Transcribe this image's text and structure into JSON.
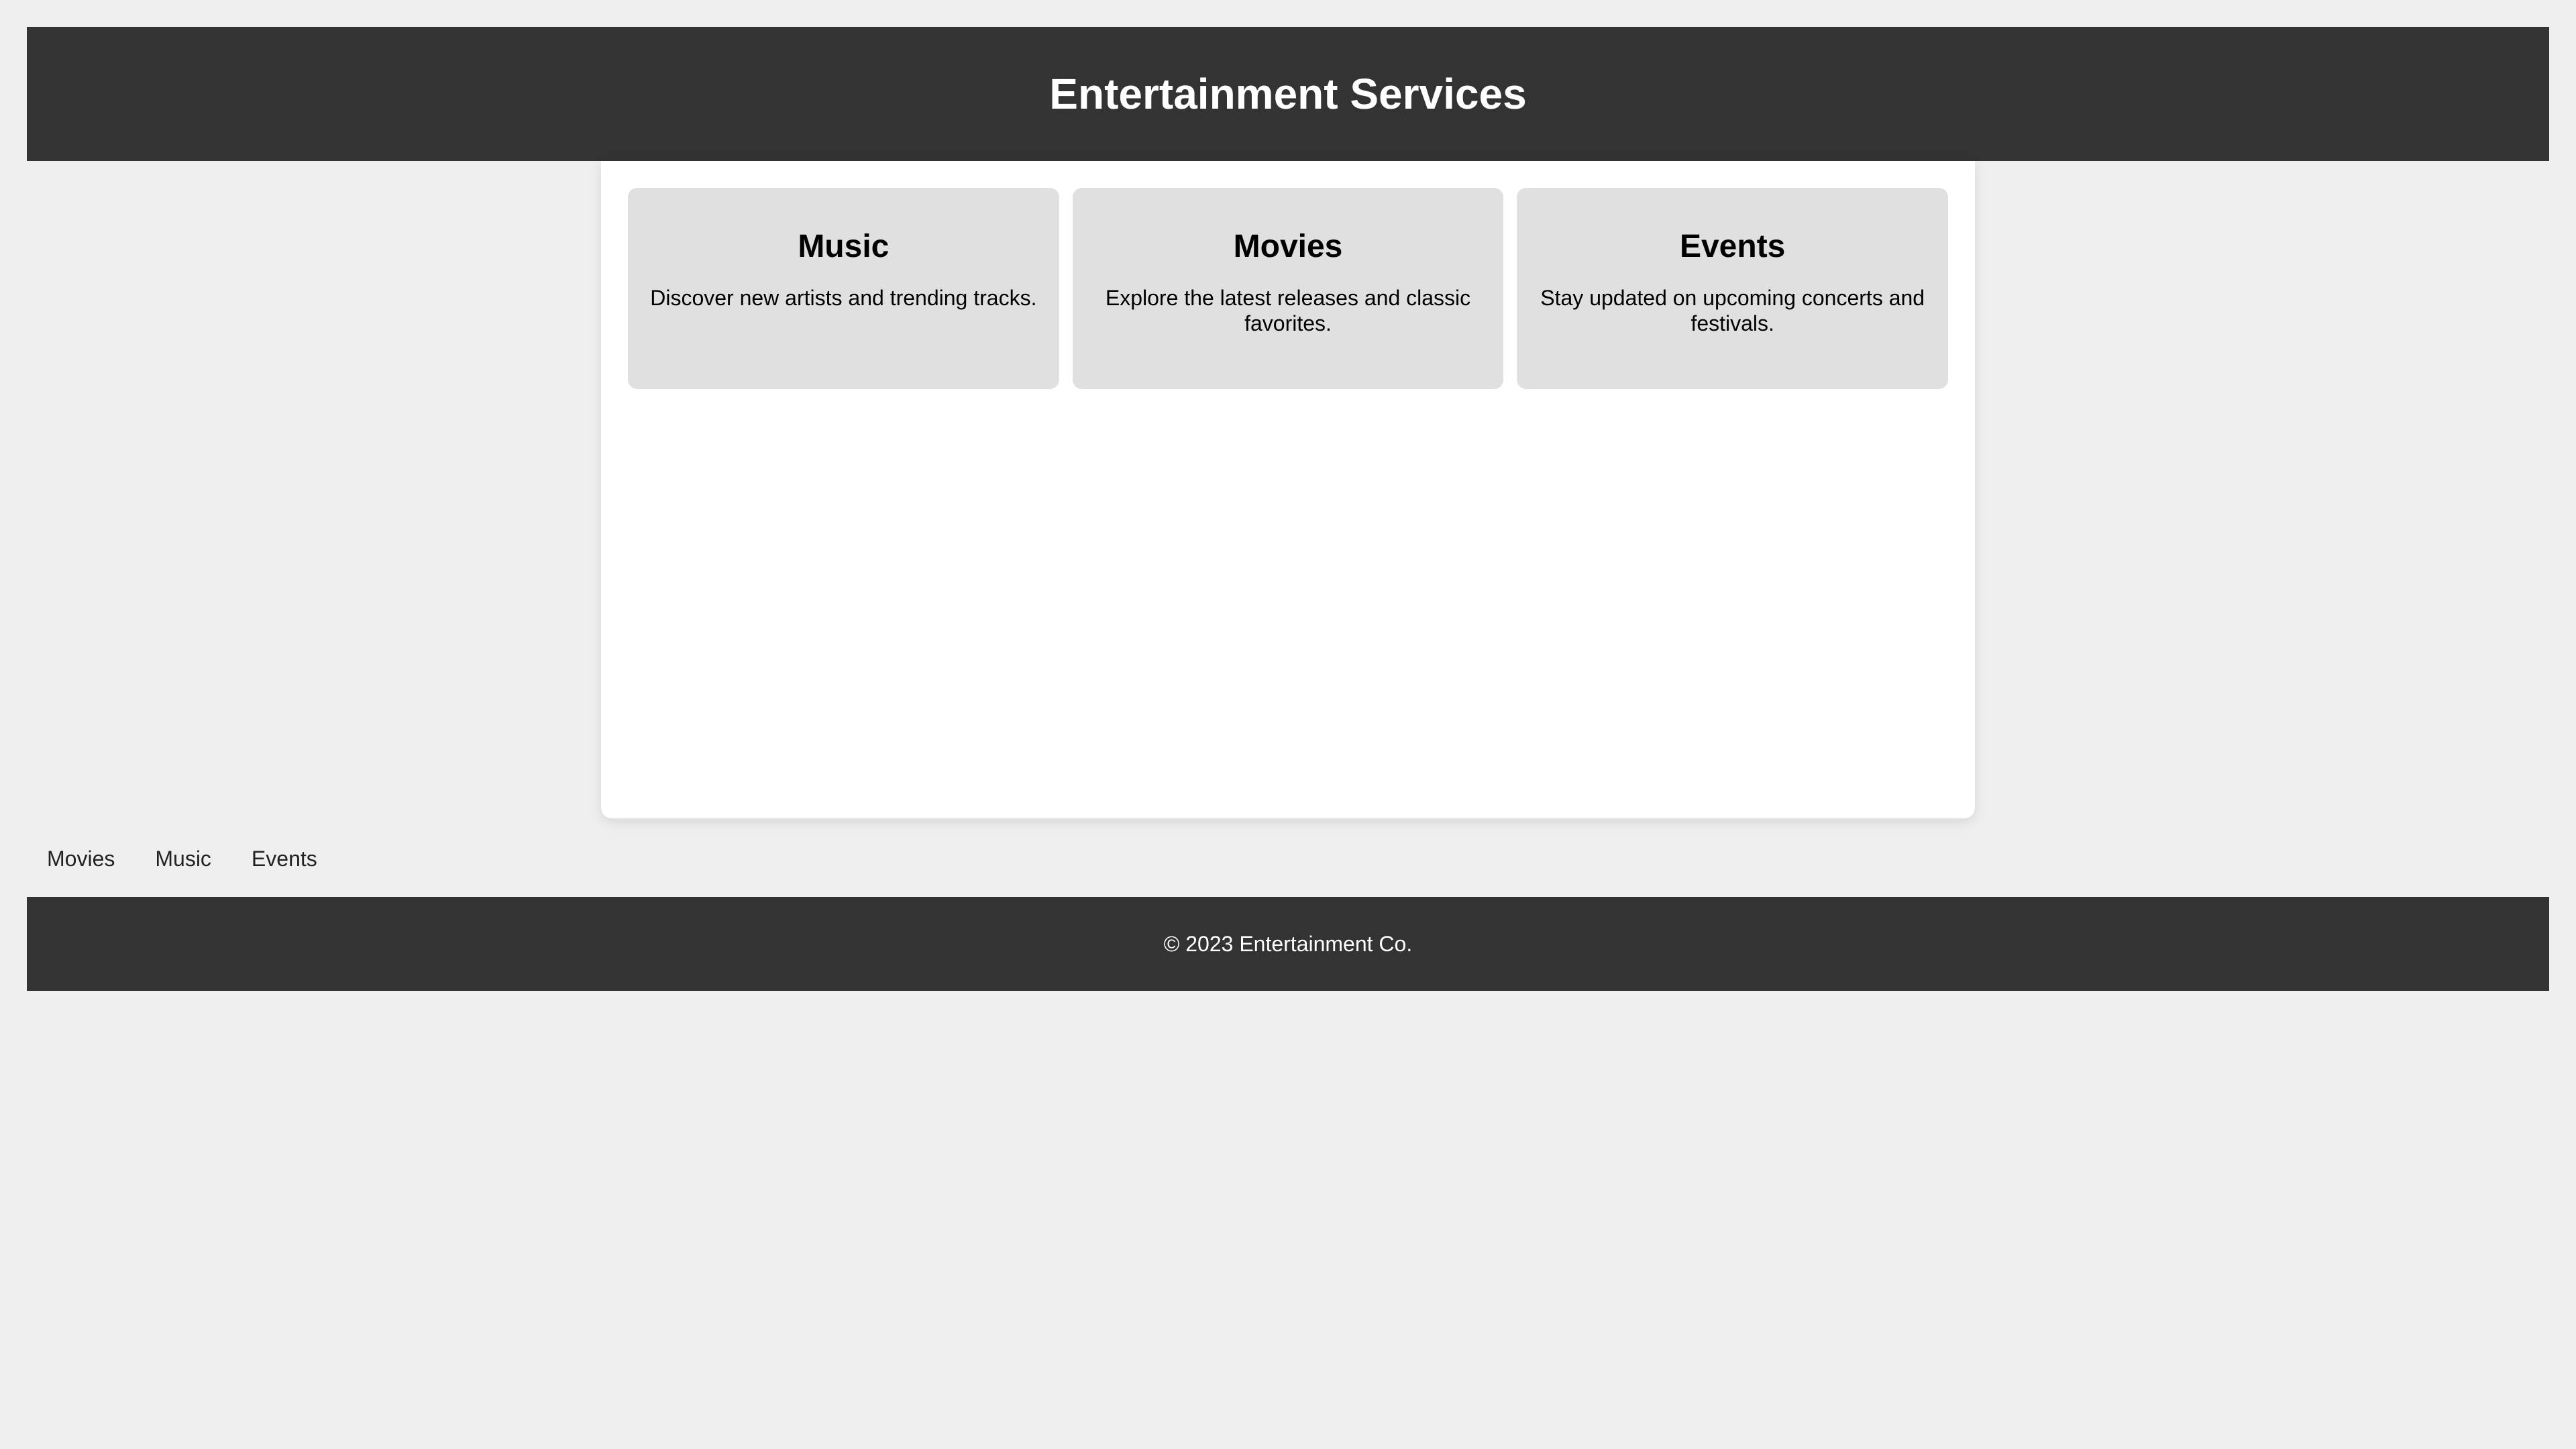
{
  "header": {
    "title": "Entertainment Services"
  },
  "cards": [
    {
      "title": "Music",
      "description": "Discover new artists and trending tracks."
    },
    {
      "title": "Movies",
      "description": "Explore the latest releases and classic favorites."
    },
    {
      "title": "Events",
      "description": "Stay updated on upcoming concerts and festivals."
    }
  ],
  "nav": {
    "links": [
      "Movies",
      "Music",
      "Events"
    ]
  },
  "footer": {
    "copyright": "© 2023 Entertainment Co."
  },
  "colors": {
    "header_bg": "#333333",
    "page_bg": "#efefef",
    "card_bg": "#e0e0e0",
    "panel_bg": "#ffffff"
  }
}
